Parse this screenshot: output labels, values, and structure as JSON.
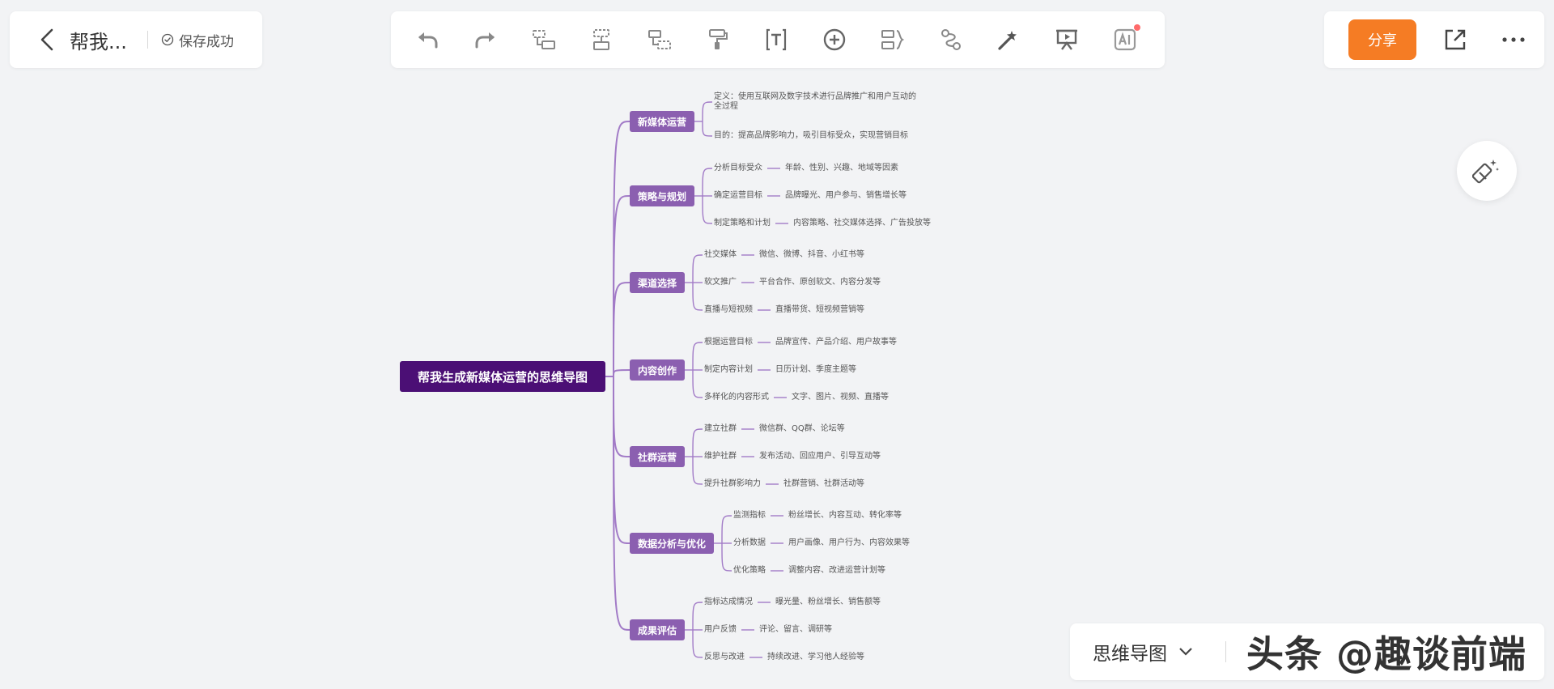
{
  "header": {
    "doc_title": "帮我...",
    "save_status": "保存成功"
  },
  "toolbar": {
    "tools": [
      "undo-icon",
      "redo-icon",
      "add-child-icon",
      "add-sibling-icon",
      "add-parent-icon",
      "format-painter-icon",
      "text-icon",
      "insert-icon",
      "summary-icon",
      "relation-icon",
      "magic-wand-icon",
      "present-icon",
      "ai-icon"
    ]
  },
  "actions": {
    "share_label": "分享"
  },
  "bottom": {
    "view_label": "思维导图",
    "watermark": "头条 @趣谈前端"
  },
  "colors": {
    "root": "#4b0f75",
    "branch": "#8b5fb0",
    "line": "#a27bc7",
    "share": "#f57c24"
  },
  "mindmap": {
    "root": "帮我生成新媒体运营的思维导图",
    "branches": [
      {
        "label": "新媒体运营",
        "items": [
          {
            "text": "定义：使用互联网及数字技术进行品牌推广和用户互动的全过程"
          },
          {
            "text": "目的：提高品牌影响力，吸引目标受众，实现营销目标"
          }
        ]
      },
      {
        "label": "策略与规划",
        "items": [
          {
            "text": "分析目标受众",
            "detail": "年龄、性别、兴趣、地域等因素"
          },
          {
            "text": "确定运营目标",
            "detail": "品牌曝光、用户参与、销售增长等"
          },
          {
            "text": "制定策略和计划",
            "detail": "内容策略、社交媒体选择、广告投放等"
          }
        ]
      },
      {
        "label": "渠道选择",
        "items": [
          {
            "text": "社交媒体",
            "detail": "微信、微博、抖音、小红书等"
          },
          {
            "text": "软文推广",
            "detail": "平台合作、原创软文、内容分发等"
          },
          {
            "text": "直播与短视频",
            "detail": "直播带货、短视频营销等"
          }
        ]
      },
      {
        "label": "内容创作",
        "items": [
          {
            "text": "根据运营目标",
            "detail": "品牌宣传、产品介绍、用户故事等"
          },
          {
            "text": "制定内容计划",
            "detail": "日历计划、季度主题等"
          },
          {
            "text": "多样化的内容形式",
            "detail": "文字、图片、视频、直播等"
          }
        ]
      },
      {
        "label": "社群运营",
        "items": [
          {
            "text": "建立社群",
            "detail": "微信群、QQ群、论坛等"
          },
          {
            "text": "维护社群",
            "detail": "发布活动、回应用户、引导互动等"
          },
          {
            "text": "提升社群影响力",
            "detail": "社群营销、社群活动等"
          }
        ]
      },
      {
        "label": "数据分析与优化",
        "items": [
          {
            "text": "监测指标",
            "detail": "粉丝增长、内容互动、转化率等"
          },
          {
            "text": "分析数据",
            "detail": "用户画像、用户行为、内容效果等"
          },
          {
            "text": "优化策略",
            "detail": "调整内容、改进运营计划等"
          }
        ]
      },
      {
        "label": "成果评估",
        "items": [
          {
            "text": "指标达成情况",
            "detail": "曝光量、粉丝增长、销售额等"
          },
          {
            "text": "用户反馈",
            "detail": "评论、留言、调研等"
          },
          {
            "text": "反思与改进",
            "detail": "持续改进、学习他人经验等"
          }
        ]
      }
    ]
  }
}
